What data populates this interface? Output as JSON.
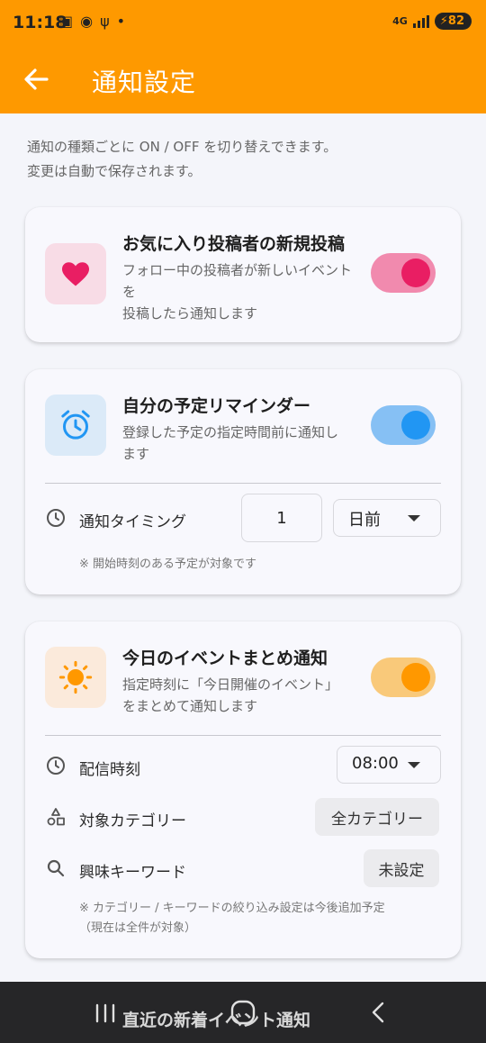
{
  "status_bar": {
    "time": "11:18",
    "network": "4G",
    "battery": "82"
  },
  "app_bar": {
    "title": "通知設定"
  },
  "intro": {
    "line1": "通知の種類ごとに ON / OFF を切り替えできます。",
    "line2": "変更は自動で保存されます。"
  },
  "cards": {
    "favorites": {
      "title": "お気に入り投稿者の新規投稿",
      "desc_line1": "フォロー中の投稿者が新しいイベント",
      "desc_line2": "を",
      "desc_line3": "投稿したら通知します",
      "enabled": true,
      "accent": "#e91e63"
    },
    "reminder": {
      "title": "自分の予定リマインダー",
      "desc_line1": "登録した予定の指定時間前に通知し",
      "desc_line2": "ます",
      "enabled": true,
      "accent": "#2196f3",
      "timing_label": "通知タイミング",
      "timing_value": "1",
      "timing_unit": "日前",
      "note": "※ 開始時刻のある予定が対象です"
    },
    "daily": {
      "title": "今日のイベントまとめ通知",
      "desc_line1": "指定時刻に「今日開催のイベント」",
      "desc_line2": "をまとめて通知します",
      "enabled": true,
      "accent": "#ff9800",
      "time_label": "配信時刻",
      "time_value": "08:00",
      "category_label": "対象カテゴリー",
      "category_value": "全カテゴリー",
      "keyword_label": "興味キーワード",
      "keyword_value": "未設定",
      "note_line1": "※ カテゴリー / キーワードの絞り込み設定は今後追加予定",
      "note_line2": "（現在は全件が対象）"
    },
    "new_events": {
      "title": "直近の新着イベント通知"
    }
  }
}
